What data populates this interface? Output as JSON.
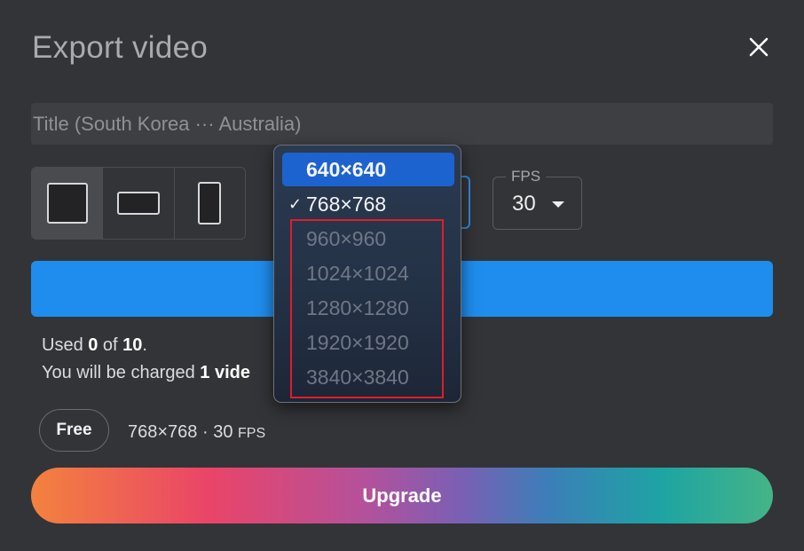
{
  "dialog": {
    "title": "Export video",
    "close_icon": "close-icon"
  },
  "title_field": {
    "value": "",
    "placeholder": "Title (South Korea ··· Australia)"
  },
  "aspect_ratios": [
    {
      "name": "square",
      "selected": true
    },
    {
      "name": "landscape",
      "selected": false
    },
    {
      "name": "portrait",
      "selected": false
    }
  ],
  "fps": {
    "label": "FPS",
    "value": "30"
  },
  "resolution_menu": {
    "options": [
      {
        "label": "640×640",
        "state": "highlighted"
      },
      {
        "label": "768×768",
        "state": "checked"
      },
      {
        "label": "960×960",
        "state": "disabled"
      },
      {
        "label": "1024×1024",
        "state": "disabled"
      },
      {
        "label": "1280×1280",
        "state": "disabled"
      },
      {
        "label": "1920×1920",
        "state": "disabled"
      },
      {
        "label": "3840×3840",
        "state": "disabled"
      }
    ],
    "check_glyph": "✓"
  },
  "usage": {
    "used_prefix": "Used ",
    "used_count": "0",
    "of_text": " of ",
    "total": "10",
    "period": ".",
    "charge_prefix": "You will be charged ",
    "charge_amount": "1 vide"
  },
  "plan": {
    "badge": "Free",
    "spec": "768×768 · 30 ",
    "spec_unit": "FPS"
  },
  "upgrade_button": {
    "label": "Upgrade"
  },
  "colors": {
    "accent": "#1f8ded",
    "menu_highlight": "#1d63cf",
    "annotation_red": "#e01c2c"
  }
}
